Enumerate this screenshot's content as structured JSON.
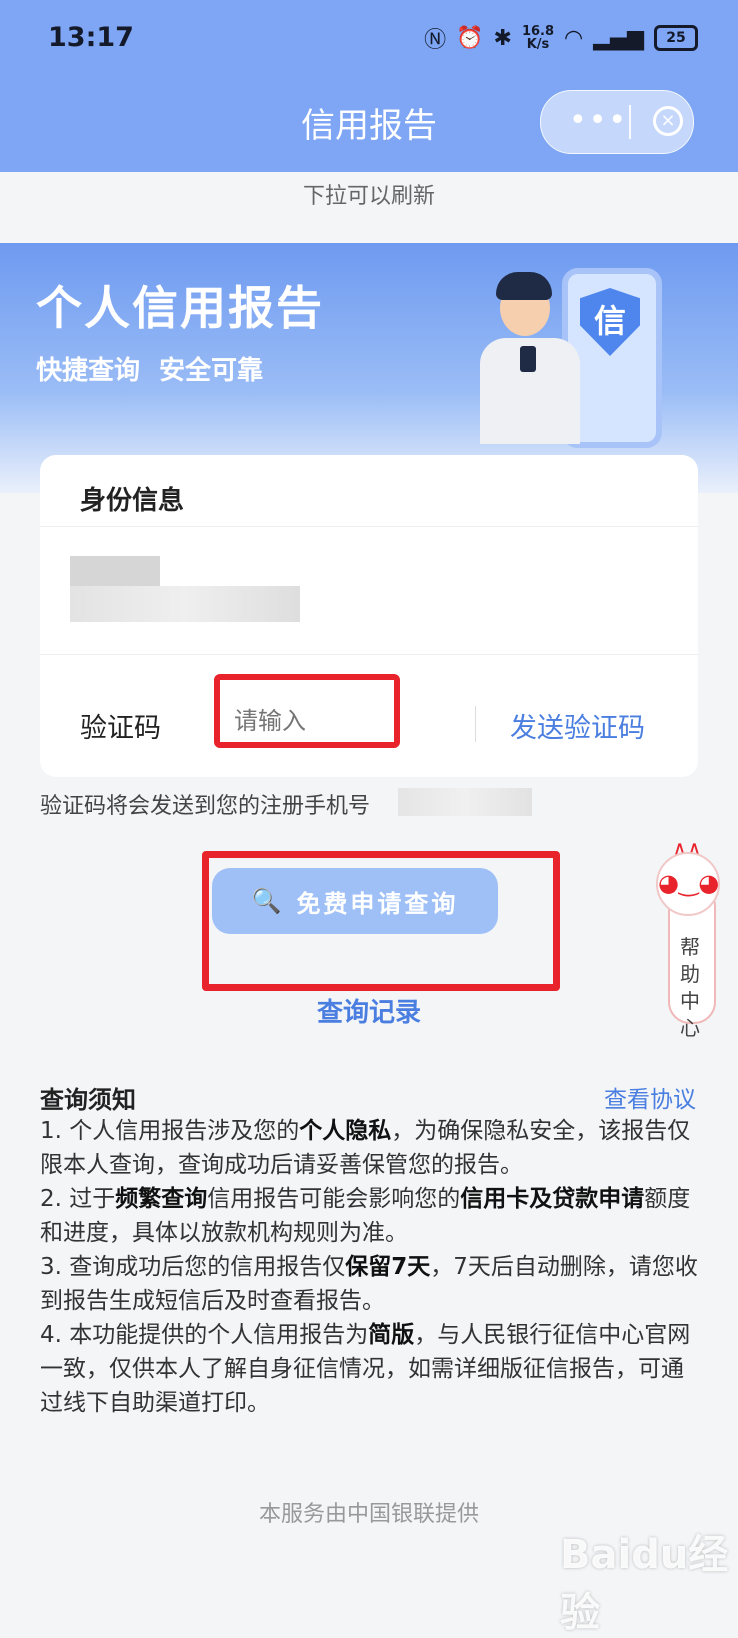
{
  "status": {
    "time": "13:17",
    "speed_top": "16.8",
    "speed_bottom": "K/s",
    "battery": "25"
  },
  "nav": {
    "title": "信用报告",
    "more": "•••",
    "close": "×"
  },
  "pull_hint": "下拉可以刷新",
  "banner": {
    "title": "个人信用报告",
    "subtitle": "快捷查询  安全可靠",
    "shield_char": "信"
  },
  "card": {
    "title": "身份信息",
    "code_label": "验证码",
    "code_placeholder": "请输入",
    "send_code": "发送验证码"
  },
  "sms_hint": "验证码将会发送到您的注册手机号",
  "submit_label": "免费申请查询",
  "records_link": "查询记录",
  "help": {
    "label": "帮助中心"
  },
  "notice": {
    "title": "查询须知",
    "agreement_link": "查看协议",
    "items": [
      {
        "pre": "1. 个人信用报告涉及您的",
        "bold": "个人隐私",
        "post": "，为确保隐私安全，该报告仅限本人查询，查询成功后请妥善保管您的报告。"
      },
      {
        "pre": "2. 过于",
        "bold": "频繁查询",
        "mid": "信用报告可能会影响您的",
        "bold2": "信用卡及贷款申请",
        "post": "额度和进度，具体以放款机构规则为准。"
      },
      {
        "pre": "3. 查询成功后您的信用报告仅",
        "bold": "保留7天",
        "post": "，7天后自动删除，请您收到报告生成短信后及时查看报告。"
      },
      {
        "pre": "4. 本功能提供的个人信用报告为",
        "bold": "简版",
        "post": "，与人民银行征信中心官网一致，仅供本人了解自身征信情况，如需详细版征信报告，可通过线下自助渠道打印。"
      }
    ]
  },
  "footer": "本服务由中国银联提供",
  "watermark": "Baidu经验",
  "colors": {
    "nav_bg": "#7ea6f4",
    "link": "#4a7ee0",
    "highlight_box": "#e8232b",
    "button": "#9fc0f7"
  }
}
